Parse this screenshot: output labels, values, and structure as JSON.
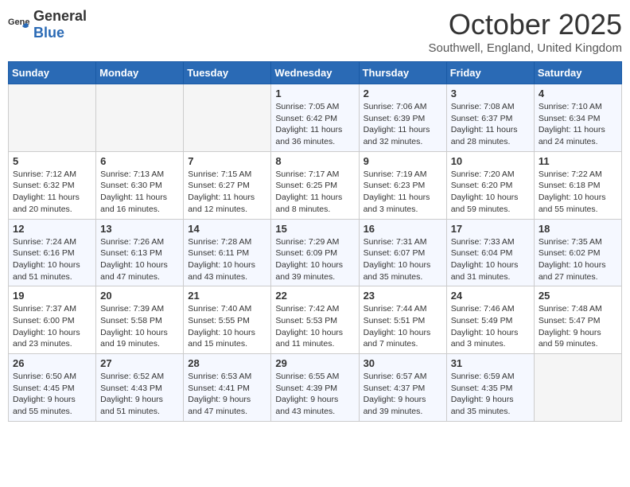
{
  "logo": {
    "general": "General",
    "blue": "Blue"
  },
  "title": "October 2025",
  "location": "Southwell, England, United Kingdom",
  "weekdays": [
    "Sunday",
    "Monday",
    "Tuesday",
    "Wednesday",
    "Thursday",
    "Friday",
    "Saturday"
  ],
  "weeks": [
    [
      {
        "day": "",
        "info": ""
      },
      {
        "day": "",
        "info": ""
      },
      {
        "day": "",
        "info": ""
      },
      {
        "day": "1",
        "info": "Sunrise: 7:05 AM\nSunset: 6:42 PM\nDaylight: 11 hours and 36 minutes."
      },
      {
        "day": "2",
        "info": "Sunrise: 7:06 AM\nSunset: 6:39 PM\nDaylight: 11 hours and 32 minutes."
      },
      {
        "day": "3",
        "info": "Sunrise: 7:08 AM\nSunset: 6:37 PM\nDaylight: 11 hours and 28 minutes."
      },
      {
        "day": "4",
        "info": "Sunrise: 7:10 AM\nSunset: 6:34 PM\nDaylight: 11 hours and 24 minutes."
      }
    ],
    [
      {
        "day": "5",
        "info": "Sunrise: 7:12 AM\nSunset: 6:32 PM\nDaylight: 11 hours and 20 minutes."
      },
      {
        "day": "6",
        "info": "Sunrise: 7:13 AM\nSunset: 6:30 PM\nDaylight: 11 hours and 16 minutes."
      },
      {
        "day": "7",
        "info": "Sunrise: 7:15 AM\nSunset: 6:27 PM\nDaylight: 11 hours and 12 minutes."
      },
      {
        "day": "8",
        "info": "Sunrise: 7:17 AM\nSunset: 6:25 PM\nDaylight: 11 hours and 8 minutes."
      },
      {
        "day": "9",
        "info": "Sunrise: 7:19 AM\nSunset: 6:23 PM\nDaylight: 11 hours and 3 minutes."
      },
      {
        "day": "10",
        "info": "Sunrise: 7:20 AM\nSunset: 6:20 PM\nDaylight: 10 hours and 59 minutes."
      },
      {
        "day": "11",
        "info": "Sunrise: 7:22 AM\nSunset: 6:18 PM\nDaylight: 10 hours and 55 minutes."
      }
    ],
    [
      {
        "day": "12",
        "info": "Sunrise: 7:24 AM\nSunset: 6:16 PM\nDaylight: 10 hours and 51 minutes."
      },
      {
        "day": "13",
        "info": "Sunrise: 7:26 AM\nSunset: 6:13 PM\nDaylight: 10 hours and 47 minutes."
      },
      {
        "day": "14",
        "info": "Sunrise: 7:28 AM\nSunset: 6:11 PM\nDaylight: 10 hours and 43 minutes."
      },
      {
        "day": "15",
        "info": "Sunrise: 7:29 AM\nSunset: 6:09 PM\nDaylight: 10 hours and 39 minutes."
      },
      {
        "day": "16",
        "info": "Sunrise: 7:31 AM\nSunset: 6:07 PM\nDaylight: 10 hours and 35 minutes."
      },
      {
        "day": "17",
        "info": "Sunrise: 7:33 AM\nSunset: 6:04 PM\nDaylight: 10 hours and 31 minutes."
      },
      {
        "day": "18",
        "info": "Sunrise: 7:35 AM\nSunset: 6:02 PM\nDaylight: 10 hours and 27 minutes."
      }
    ],
    [
      {
        "day": "19",
        "info": "Sunrise: 7:37 AM\nSunset: 6:00 PM\nDaylight: 10 hours and 23 minutes."
      },
      {
        "day": "20",
        "info": "Sunrise: 7:39 AM\nSunset: 5:58 PM\nDaylight: 10 hours and 19 minutes."
      },
      {
        "day": "21",
        "info": "Sunrise: 7:40 AM\nSunset: 5:55 PM\nDaylight: 10 hours and 15 minutes."
      },
      {
        "day": "22",
        "info": "Sunrise: 7:42 AM\nSunset: 5:53 PM\nDaylight: 10 hours and 11 minutes."
      },
      {
        "day": "23",
        "info": "Sunrise: 7:44 AM\nSunset: 5:51 PM\nDaylight: 10 hours and 7 minutes."
      },
      {
        "day": "24",
        "info": "Sunrise: 7:46 AM\nSunset: 5:49 PM\nDaylight: 10 hours and 3 minutes."
      },
      {
        "day": "25",
        "info": "Sunrise: 7:48 AM\nSunset: 5:47 PM\nDaylight: 9 hours and 59 minutes."
      }
    ],
    [
      {
        "day": "26",
        "info": "Sunrise: 6:50 AM\nSunset: 4:45 PM\nDaylight: 9 hours and 55 minutes."
      },
      {
        "day": "27",
        "info": "Sunrise: 6:52 AM\nSunset: 4:43 PM\nDaylight: 9 hours and 51 minutes."
      },
      {
        "day": "28",
        "info": "Sunrise: 6:53 AM\nSunset: 4:41 PM\nDaylight: 9 hours and 47 minutes."
      },
      {
        "day": "29",
        "info": "Sunrise: 6:55 AM\nSunset: 4:39 PM\nDaylight: 9 hours and 43 minutes."
      },
      {
        "day": "30",
        "info": "Sunrise: 6:57 AM\nSunset: 4:37 PM\nDaylight: 9 hours and 39 minutes."
      },
      {
        "day": "31",
        "info": "Sunrise: 6:59 AM\nSunset: 4:35 PM\nDaylight: 9 hours and 35 minutes."
      },
      {
        "day": "",
        "info": ""
      }
    ]
  ]
}
